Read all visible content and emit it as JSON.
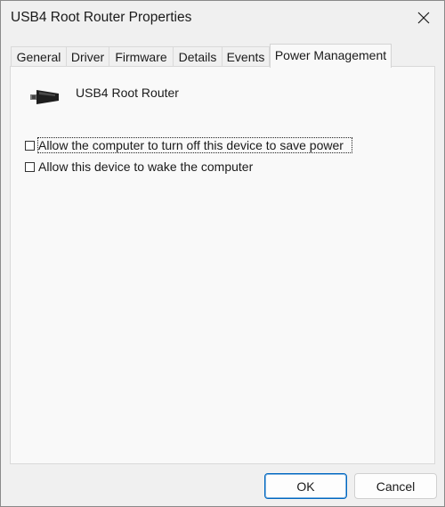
{
  "window": {
    "title": "USB4 Root Router Properties"
  },
  "tabs": [
    {
      "label": "General",
      "active": false
    },
    {
      "label": "Driver",
      "active": false
    },
    {
      "label": "Firmware",
      "active": false
    },
    {
      "label": "Details",
      "active": false
    },
    {
      "label": "Events",
      "active": false
    },
    {
      "label": "Power Management",
      "active": true
    }
  ],
  "device": {
    "icon": "usb-connector-icon",
    "name": "USB4 Root Router"
  },
  "options": [
    {
      "label": "Allow the computer to turn off this device to save power",
      "checked": false,
      "focused": true
    },
    {
      "label": "Allow this device to wake the computer",
      "checked": false,
      "focused": false
    }
  ],
  "buttons": {
    "ok": "OK",
    "cancel": "Cancel"
  }
}
